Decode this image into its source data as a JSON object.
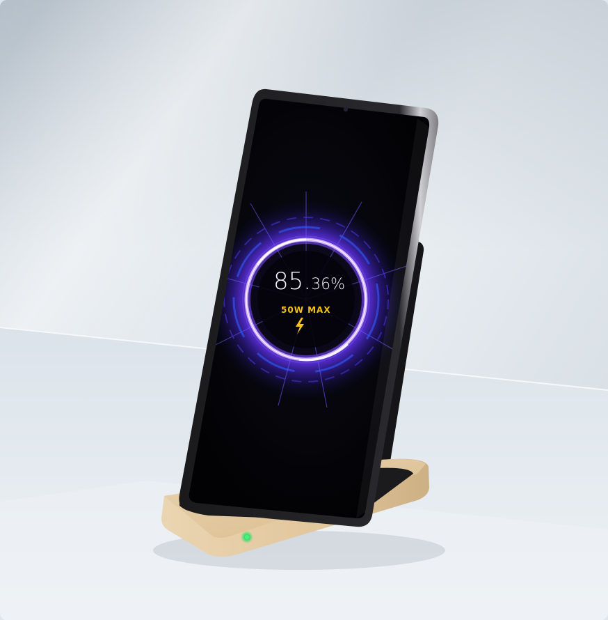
{
  "screen": {
    "charge_whole": "85.",
    "charge_decimals": "36%",
    "power_label": "50W MAX",
    "bolt_icon": "lightning-bolt-icon"
  },
  "colors": {
    "ring_glow": "#7b4dff",
    "ring_core": "#efe6ff",
    "power_text": "#f5c21b",
    "stand_gold": "#e2c79f",
    "led_green": "#35e06b",
    "phone_screen": "#050508"
  }
}
